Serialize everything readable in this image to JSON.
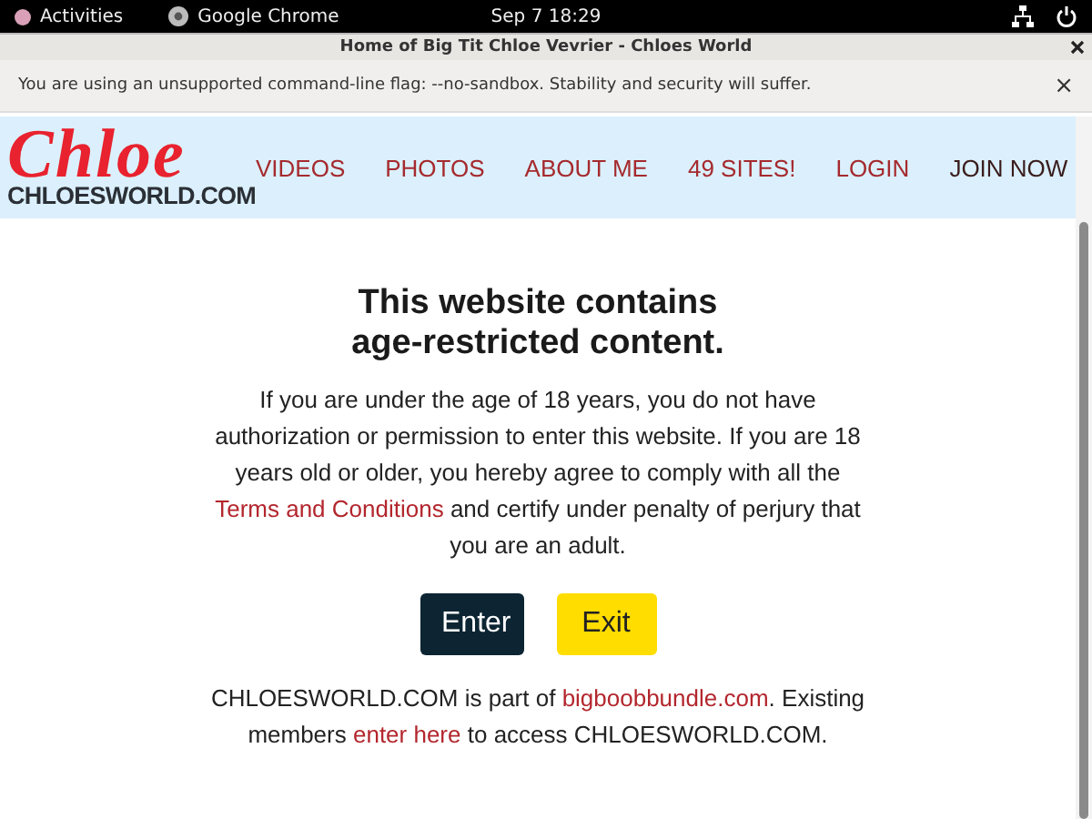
{
  "system_bar": {
    "activities": "Activities",
    "app": "Google Chrome",
    "clock": "Sep 7  18:29"
  },
  "window": {
    "title": "Home of Big Tit Chloe Vevrier - Chloes World"
  },
  "infobar": {
    "message": "You are using an unsupported command-line flag: --no-sandbox. Stability and security will suffer.",
    "close": "×"
  },
  "header": {
    "logo_script": "Chloe",
    "logo_domain": "CHLOESWORLD.COM",
    "nav": [
      {
        "label": "VIDEOS",
        "kind": "link"
      },
      {
        "label": "PHOTOS",
        "kind": "link"
      },
      {
        "label": "ABOUT ME",
        "kind": "link"
      },
      {
        "label": "49 SITES!",
        "kind": "link"
      },
      {
        "label": "LOGIN",
        "kind": "link"
      },
      {
        "label": "JOIN NOW",
        "kind": "join"
      }
    ]
  },
  "gate": {
    "heading_lines": [
      "This website contains",
      "age-restricted content."
    ],
    "notice": [
      {
        "kind": "text",
        "text": "If you are under the age of 18 years, you do not have authorization or permission to enter this website. If you are 18 years old or older, you hereby agree to comply with all the "
      },
      {
        "kind": "link",
        "text": "Terms and Conditions"
      },
      {
        "kind": "text",
        "text": " and certify under penalty of perjury that you are an adult."
      }
    ],
    "buttons": [
      {
        "label": "Enter",
        "kind": "enter"
      },
      {
        "label": "Exit",
        "kind": "exit"
      }
    ],
    "footer": [
      {
        "kind": "text",
        "text": "CHLOESWORLD.COM is part of "
      },
      {
        "kind": "link",
        "text": "bigboobbundle.com"
      },
      {
        "kind": "text",
        "text": ". Existing members "
      },
      {
        "kind": "link",
        "text": "enter here"
      },
      {
        "kind": "text",
        "text": " to access CHLOESWORLD.COM."
      }
    ]
  }
}
